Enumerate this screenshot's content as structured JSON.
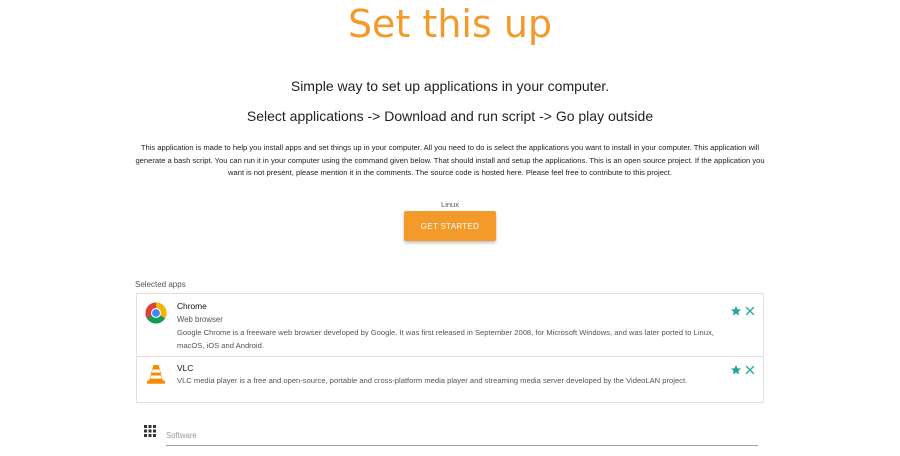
{
  "header": {
    "title": "Set this up",
    "tagline": "Simple way to set up applications in your computer.",
    "steps": "Select applications -> Download and run script -> Go play outside"
  },
  "intro": {
    "description": "This application is made to help you install apps and set things up in your computer. All you need to do is select the applications you want to install in your computer. This application will generate a bash script. You can run it in your computer using the command given below. That should install and setup the applications. This is an open source project. If the application you want is not present, please mention it in the comments. The source code is hosted here. Please feel free to contribute to this project."
  },
  "platform": {
    "os_label": "Linux",
    "get_started_label": "GET STARTED"
  },
  "selected": {
    "label": "Selected apps",
    "apps": [
      {
        "name": "Chrome",
        "type": "Web browser",
        "description": "Google Chrome is a freeware web browser developed by Google. It was first released in September 2008, for Microsoft Windows, and was later ported to Linux, macOS, iOS and Android.",
        "icon": "chrome-icon"
      },
      {
        "name": "VLC",
        "type": "",
        "description": "VLC media player is a free and open-source, portable and cross-platform media player and streaming media server developed by the VideoLAN project.",
        "icon": "vlc-cone-icon"
      }
    ],
    "star_icon": "star-icon",
    "remove_icon": "close-icon"
  },
  "search": {
    "placeholder": "Software",
    "value": "",
    "icon": "apps-grid-icon"
  },
  "colors": {
    "accent": "#f39a2b",
    "action": "#26a69a"
  }
}
